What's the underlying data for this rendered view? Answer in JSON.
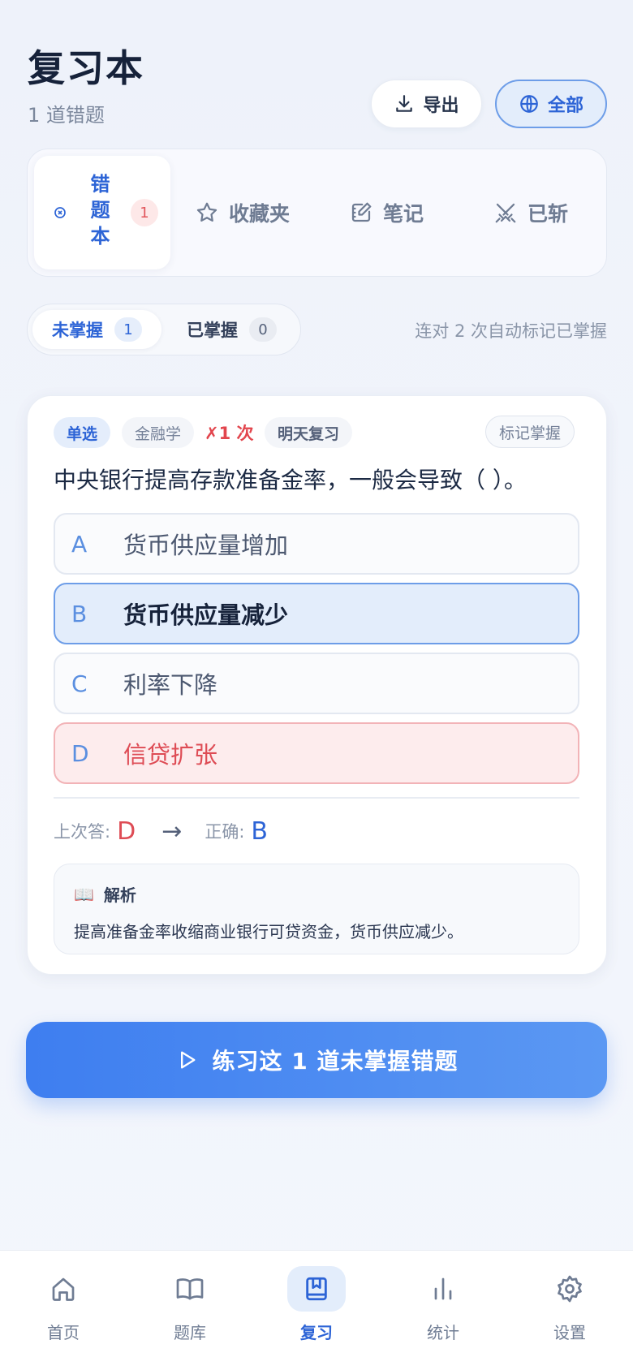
{
  "header": {
    "title": "复习本",
    "subtitle": "1 道错题",
    "export_label": "导出",
    "filter_label": "全部"
  },
  "tabs": [
    {
      "label": "错题本",
      "count": "1",
      "icon": "x-circle-icon",
      "active": true
    },
    {
      "label": "收藏夹",
      "icon": "star-icon"
    },
    {
      "label": "笔记",
      "icon": "note-edit-icon"
    },
    {
      "label": "已斩",
      "icon": "crossed-swords-icon"
    }
  ],
  "segment": {
    "unmastered_label": "未掌握",
    "unmastered_count": "1",
    "mastered_label": "已掌握",
    "mastered_count": "0",
    "hint": "连对 2 次自动标记已掌握"
  },
  "card": {
    "type_chip": "单选",
    "subject_chip": "金融学",
    "wrong_chip": "✗1 次",
    "review_chip": "明天复习",
    "mark_button": "标记掌握",
    "question": "中央银行提高存款准备金率，一般会导致（ ）。",
    "options": [
      {
        "letter": "A",
        "text": "货币供应量增加"
      },
      {
        "letter": "B",
        "text": "货币供应量减少"
      },
      {
        "letter": "C",
        "text": "利率下降"
      },
      {
        "letter": "D",
        "text": "信贷扩张"
      }
    ],
    "last_answer_label": "上次答:",
    "last_answer": "D",
    "arrow": "→",
    "correct_label": "正确:",
    "correct_answer": "B",
    "explain_icon": "📖",
    "explain_title": "解析",
    "explain_body": "提高准备金率收缩商业银行可贷资金，货币供应减少。"
  },
  "cta_label": "练习这 1 道未掌握错题",
  "nav": [
    {
      "label": "首页",
      "icon": "home-icon"
    },
    {
      "label": "题库",
      "icon": "book-open-icon"
    },
    {
      "label": "复习",
      "icon": "bookmark-book-icon",
      "active": true
    },
    {
      "label": "统计",
      "icon": "bar-chart-icon"
    },
    {
      "label": "设置",
      "icon": "gear-icon"
    }
  ],
  "colors": {
    "accent": "#2d64d6",
    "danger": "#de4c55",
    "cta_start": "#3e7ef0",
    "cta_end": "#5b98f3"
  }
}
